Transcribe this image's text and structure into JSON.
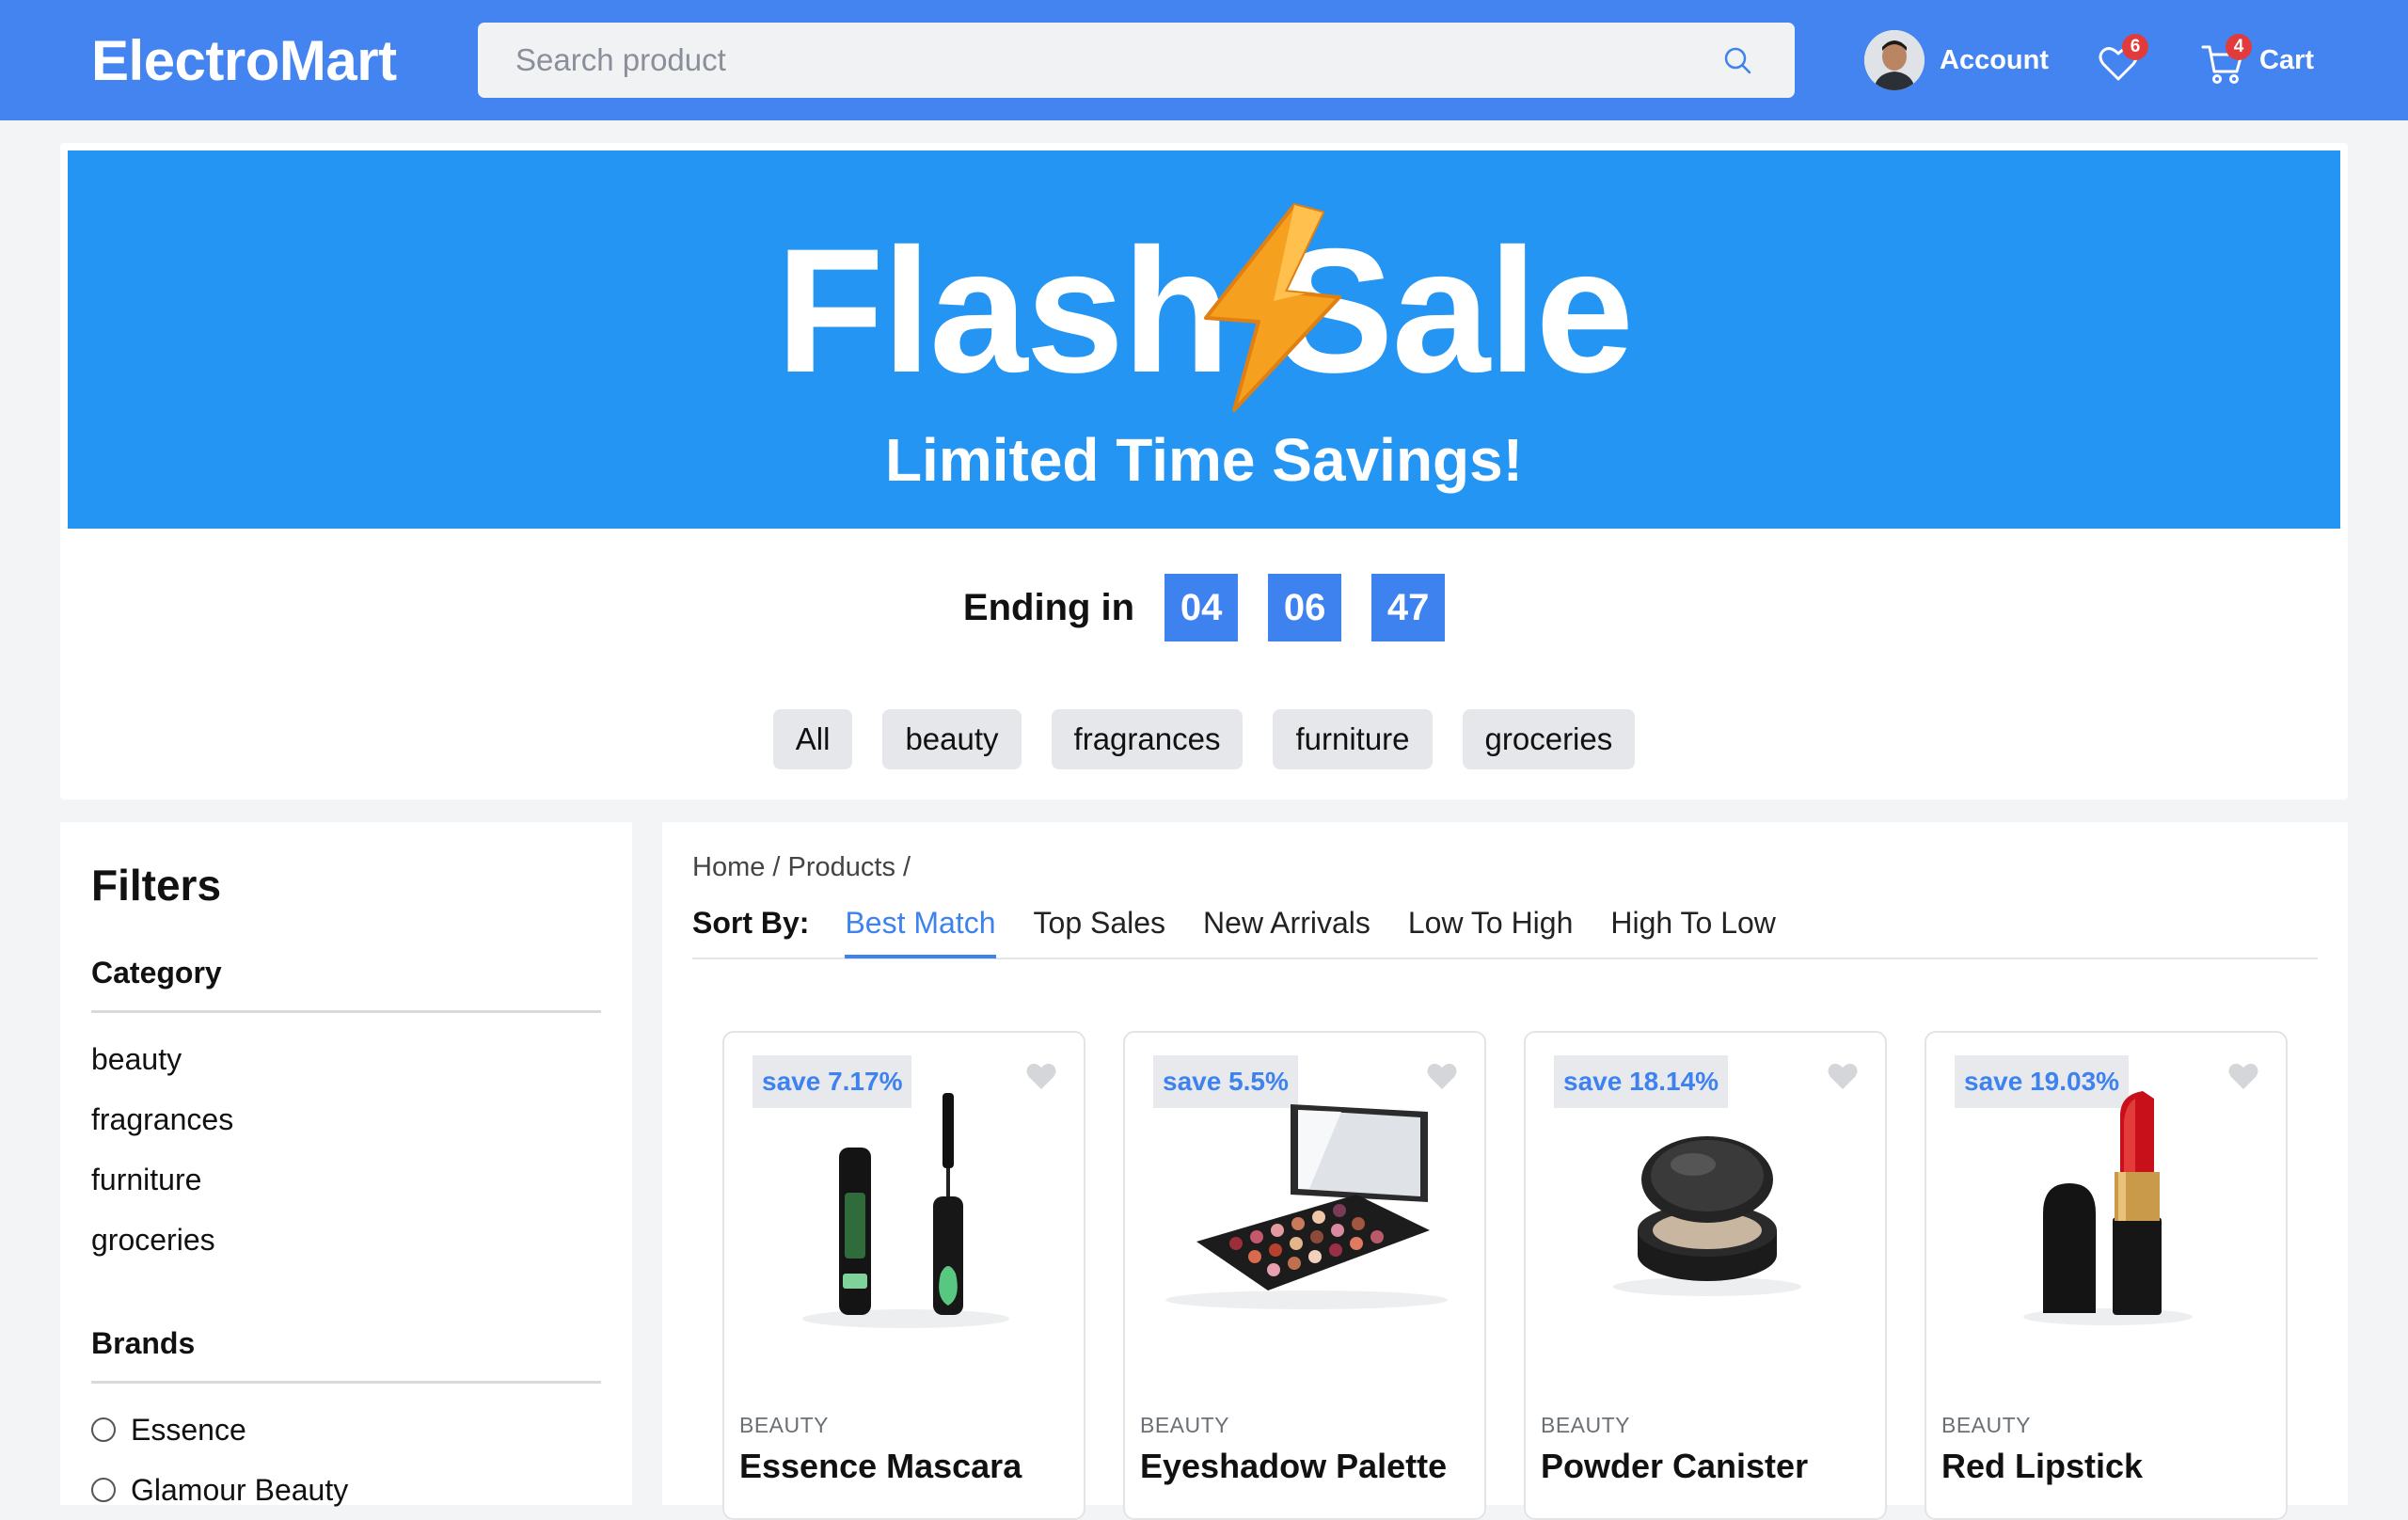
{
  "header": {
    "logo": "ElectroMart",
    "search_placeholder": "Search product",
    "account_label": "Account",
    "wishlist_count": "6",
    "cart_count": "4",
    "cart_label": "Cart"
  },
  "sale": {
    "title": "Flash Sale",
    "subtitle": "Limited Time Savings!",
    "countdown_label": "Ending in",
    "countdown": [
      "04",
      "06",
      "47"
    ],
    "chips": [
      "All",
      "beauty",
      "fragrances",
      "furniture",
      "groceries"
    ]
  },
  "filters": {
    "title": "Filters",
    "category_title": "Category",
    "categories": [
      "beauty",
      "fragrances",
      "furniture",
      "groceries"
    ],
    "brands_title": "Brands",
    "brands": [
      "Essence",
      "Glamour Beauty"
    ]
  },
  "products": {
    "breadcrumb": "Home / Products /",
    "sort_label": "Sort By:",
    "sort_options": [
      "Best Match",
      "Top Sales",
      "New Arrivals",
      "Low To High",
      "High To Low"
    ],
    "items": [
      {
        "save": "save 7.17%",
        "category": "BEAUTY",
        "name": "Essence Mascara"
      },
      {
        "save": "save 5.5%",
        "category": "BEAUTY",
        "name": "Eyeshadow Palette"
      },
      {
        "save": "save 18.14%",
        "category": "BEAUTY",
        "name": "Powder Canister"
      },
      {
        "save": "save 19.03%",
        "category": "BEAUTY",
        "name": "Red Lipstick"
      }
    ]
  },
  "colors": {
    "header": "#4384f1",
    "banner": "#2495f3",
    "accent": "#3d82ee",
    "badge": "#e23b3b"
  }
}
